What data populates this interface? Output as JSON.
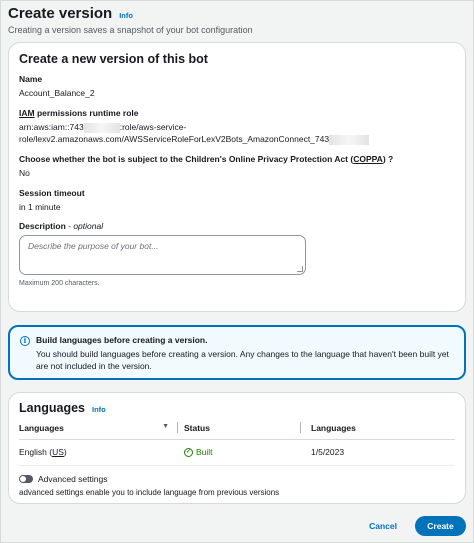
{
  "header": {
    "title": "Create version",
    "info": "Info",
    "subtitle": "Creating a version saves a snapshot of your bot configuration"
  },
  "main_card": {
    "title": "Create a new version of this bot",
    "name_label": "Name",
    "name_value": "Account_Balance_2",
    "iam_label_abbr": "IAM",
    "iam_label_rest": " permissions runtime role",
    "iam_line1_a": "arn:aws:iam::743",
    "iam_line1_b": ":role/aws-service-",
    "iam_line2_a": "role/lexv2.amazonaws.com/AWSServiceRoleForLexV2Bots_AmazonConnect_743",
    "coppa_label_a": "Choose whether the bot is subject to the Children's Online Privacy Protection Act (",
    "coppa_label_abbr": "COPPA",
    "coppa_label_b": ") ?",
    "coppa_value": "No",
    "session_label": "Session timeout",
    "session_value": "in 1 minute",
    "description_label": "Description",
    "description_optional": " - optional",
    "description_placeholder": "Describe the purpose of your bot...",
    "description_hint": "Maximum 200 characters."
  },
  "alert": {
    "title": "Build languages before creating a version.",
    "body": "You should build languages before creating a version. Any changes to the language that haven't been built yet are not included in the version."
  },
  "languages": {
    "title": "Languages",
    "info": "Info",
    "columns": [
      "Languages",
      "Status",
      "Languages"
    ],
    "rows": [
      {
        "language_a": "English (",
        "language_abbr": "US",
        "language_b": ")",
        "status": "Built",
        "date": "1/5/2023"
      }
    ],
    "advanced_label": "Advanced settings",
    "advanced_desc": "advanced settings enable you to include language from previous versions",
    "advanced_enabled": false
  },
  "footer": {
    "cancel": "Cancel",
    "create": "Create"
  },
  "colors": {
    "accent": "#0073bb",
    "success": "#1d8102",
    "alert_bg": "#f1faff"
  }
}
